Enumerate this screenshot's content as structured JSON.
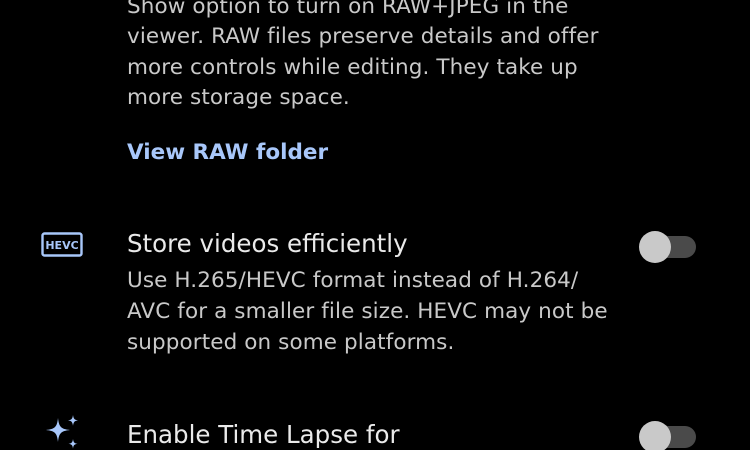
{
  "raw_setting": {
    "description_lines": [
      "Show option to turn on RAW+JPEG in the",
      "viewer. RAW files preserve details and offer",
      "more controls while editing. They take up",
      "more storage space."
    ],
    "link_label": "View RAW folder"
  },
  "hevc_setting": {
    "icon": "hevc-icon",
    "icon_text": "HEVC",
    "title": "Store videos efficiently",
    "description_lines": [
      "Use H.265/HEVC format instead of H.264/",
      "AVC for a smaller file size. HEVC may not be",
      "supported on some platforms."
    ],
    "toggle_on": false
  },
  "timelapse_setting": {
    "icon": "sparkle-icon",
    "title": "Enable Time Lapse for",
    "toggle_on": false
  },
  "colors": {
    "background": "#000000",
    "link": "#a8c7fa",
    "icon_accent": "#a8c7fa",
    "toggle_track_off": "#4a4a4a",
    "toggle_thumb_off": "#c9c9c9"
  }
}
